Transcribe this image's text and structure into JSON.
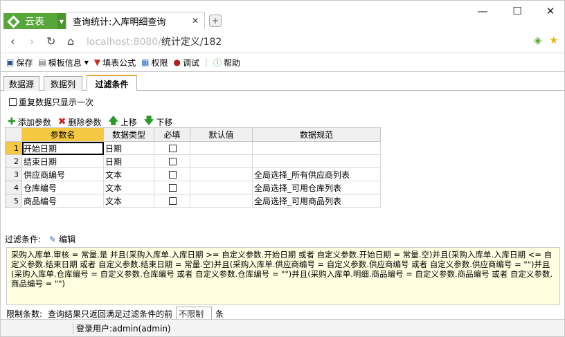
{
  "browser": {
    "app_name": "云表",
    "tab_title": "查询统计:入库明细查询",
    "url_host": "localhost:8080/",
    "url_path": "统计定义/182",
    "new_tab": "+"
  },
  "toolbar": {
    "save": "保存",
    "template_info": "模板信息",
    "fill_formula": "填表公式",
    "permission": "权限",
    "debug": "调试",
    "help": "帮助"
  },
  "tabs": [
    "数据源",
    "数据列",
    "过滤条件"
  ],
  "options": {
    "unique_rows": "重复数据只显示一次"
  },
  "actions": {
    "add": "添加参数",
    "delete": "删除参数",
    "up": "上移",
    "down": "下移"
  },
  "grid": {
    "headers": [
      "参数名",
      "数据类型",
      "必填",
      "默认值",
      "数据规范"
    ],
    "rows": [
      {
        "no": "1",
        "name": "开始日期",
        "type": "日期",
        "required": false,
        "default": "",
        "spec": ""
      },
      {
        "no": "2",
        "name": "结束日期",
        "type": "日期",
        "required": false,
        "default": "",
        "spec": ""
      },
      {
        "no": "3",
        "name": "供应商编号",
        "type": "文本",
        "required": false,
        "default": "",
        "spec": "全局选择_所有供应商列表"
      },
      {
        "no": "4",
        "name": "仓库编号",
        "type": "文本",
        "required": false,
        "default": "",
        "spec": "全局选择_可用仓库列表"
      },
      {
        "no": "5",
        "name": "商品编号",
        "type": "文本",
        "required": false,
        "default": "",
        "spec": "全局选择_可用商品列表"
      }
    ]
  },
  "filter": {
    "label": "过滤条件:",
    "edit": "编辑",
    "expression": "采购入库单.审核 = 常量.是 并且(采购入库单.入库日期 >= 自定义参数.开始日期 或者 自定义参数.开始日期 = 常量.空)并且(采购入库单.入库日期 <= 自定义参数.结束日期 或者 自定义参数.结束日期 = 常量.空)并且(采购入库单.供应商编号 = 自定义参数.供应商编号 或者 自定义参数.供应商编号 = \"\")并且(采购入库单.仓库编号 = 自定义参数.仓库编号 或者 自定义参数.仓库编号 = \"\")并且(采购入库单.明细.商品编号 = 自定义参数.商品编号 或者 自定义参数.商品编号 = \"\")"
  },
  "limit": {
    "label": "限制条数:",
    "text": "查询结果只返回满足过滤条件的前",
    "value": "不限制",
    "unit": "条"
  },
  "status": {
    "user": "登录用户:admin(admin)"
  },
  "colors": {
    "app_green": "#57a639",
    "selected_header": "#f5c842",
    "filter_bg": "#ffffe1"
  }
}
